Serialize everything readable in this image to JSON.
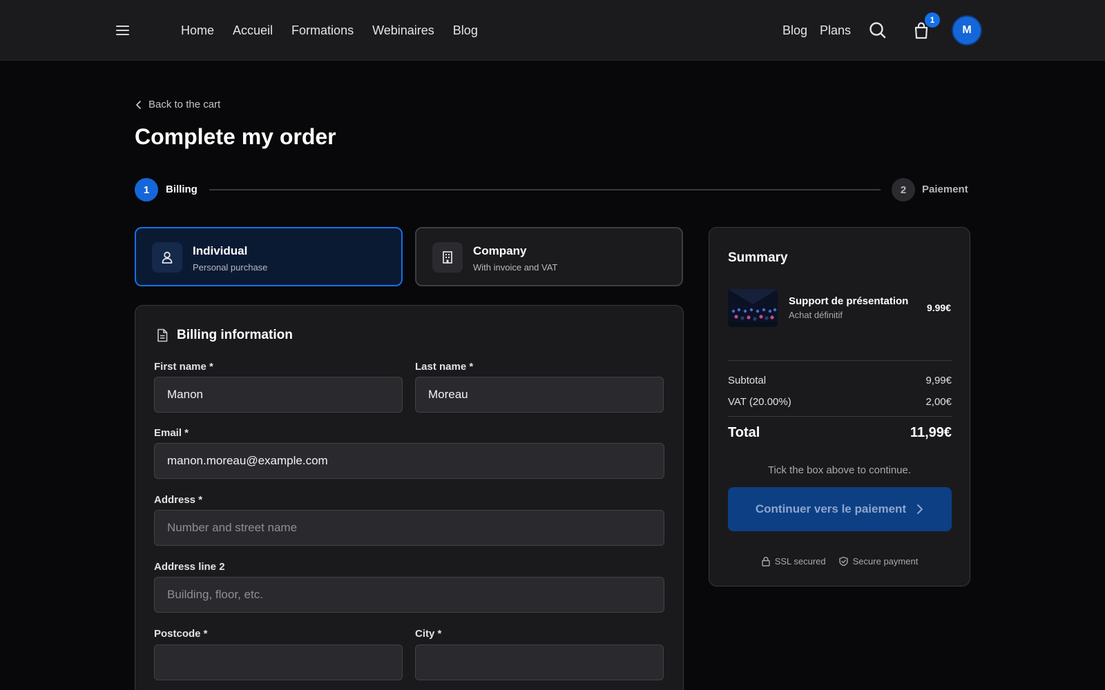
{
  "header": {
    "nav_left": [
      "Home",
      "Accueil",
      "Formations",
      "Webinaires",
      "Blog"
    ],
    "nav_right": [
      "Blog",
      "Plans"
    ],
    "cart_count": "1",
    "avatar_initial": "M",
    "icons": [
      "menu-icon",
      "search-icon",
      "shopping-bag-icon"
    ]
  },
  "page": {
    "back_label": "Back to the cart",
    "title": "Complete my order"
  },
  "stepper": {
    "steps": [
      {
        "number": "1",
        "label": "Billing",
        "state": "active"
      },
      {
        "number": "2",
        "label": "Paiement",
        "state": "inactive"
      }
    ]
  },
  "account_types": [
    {
      "title": "Individual",
      "subtitle": "Personal purchase",
      "selected": true,
      "icon": "user-icon"
    },
    {
      "title": "Company",
      "subtitle": "With invoice and VAT",
      "selected": false,
      "icon": "building-icon"
    }
  ],
  "billing": {
    "heading": "Billing information",
    "icon": "document-icon",
    "fields": {
      "first_name": {
        "label": "First name *",
        "value": "Manon",
        "placeholder": ""
      },
      "last_name": {
        "label": "Last name *",
        "value": "Moreau",
        "placeholder": ""
      },
      "email": {
        "label": "Email *",
        "value": "manon.moreau@example.com",
        "placeholder": ""
      },
      "address": {
        "label": "Address *",
        "value": "",
        "placeholder": "Number and street name"
      },
      "address2": {
        "label": "Address line 2",
        "value": "",
        "placeholder": "Building, floor, etc."
      },
      "postcode": {
        "label": "Postcode *",
        "value": "",
        "placeholder": ""
      },
      "city": {
        "label": "City *",
        "value": "",
        "placeholder": ""
      }
    }
  },
  "summary": {
    "title": "Summary",
    "item": {
      "name": "Support de présentation",
      "subtitle": "Achat définitif",
      "price": "9.99€"
    },
    "subtotal_label": "Subtotal",
    "subtotal_value": "9,99€",
    "vat_label": "VAT (20.00%)",
    "vat_value": "2,00€",
    "total_label": "Total",
    "total_value": "11,99€",
    "hint": "Tick the box above to continue.",
    "cta_label": "Continuer vers le paiement",
    "badges": [
      "SSL secured",
      "Secure payment"
    ]
  },
  "colors": {
    "accent": "#1570e6",
    "background": "#08080a",
    "surface": "#1a1a1d",
    "header": "#1b1b1e",
    "cta_disabled": "#0d3f84"
  }
}
